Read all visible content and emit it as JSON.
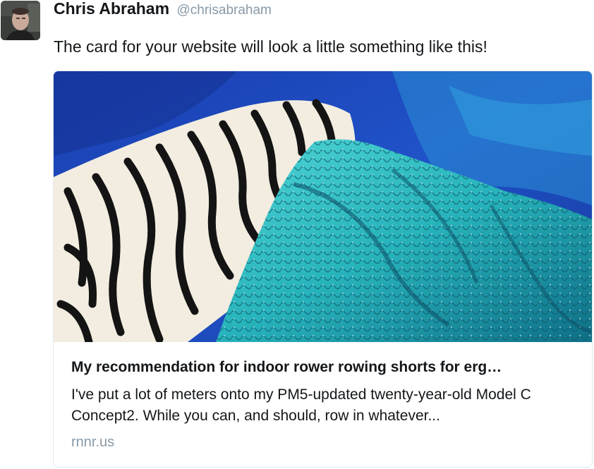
{
  "author": {
    "name": "Chris Abraham",
    "handle": "@chrisabraham"
  },
  "tweet": {
    "text": "The card for your website will look a little something like this!"
  },
  "card": {
    "title": "My recommendation for indoor rower rowing shorts for erg…",
    "description": "I've put a lot of meters onto my PM5-updated twenty-year-old Model C Concept2. While you can, and should, row in whatever...",
    "domain": "rnnr.us"
  },
  "colors": {
    "text": "#14171a",
    "muted": "#8899a6",
    "card_border": "#e1e8ed",
    "photo_blue": "#1f45b8",
    "photo_teal": "#2fb8bf"
  }
}
